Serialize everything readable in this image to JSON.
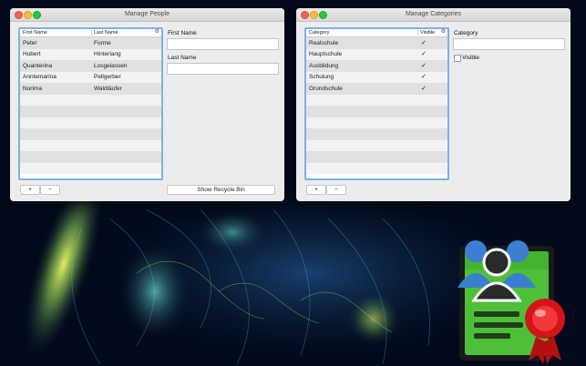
{
  "people_window": {
    "title": "Manage People",
    "columns": [
      "First Name",
      "Last Name"
    ],
    "rows": [
      {
        "first": "Peter",
        "last": "Forme"
      },
      {
        "first": "Hubert",
        "last": "Hinterlang"
      },
      {
        "first": "Quanterina",
        "last": "Losgelassen"
      },
      {
        "first": "Anntemarina",
        "last": "Pellgerber"
      },
      {
        "first": "Nurima",
        "last": "Waldläufer"
      }
    ],
    "add_label": "+",
    "remove_label": "−",
    "first_name_label": "First Name",
    "last_name_label": "Last Name",
    "first_name_value": "",
    "last_name_value": "",
    "recycle_bin_label": "Show Recycle Bin"
  },
  "categories_window": {
    "title": "Manage Categories",
    "columns": [
      "Category",
      "Visible"
    ],
    "rows": [
      {
        "name": "Realschule",
        "visible": "✓"
      },
      {
        "name": "Hauptschule",
        "visible": "✓"
      },
      {
        "name": "Ausbildung",
        "visible": "✓"
      },
      {
        "name": "Schulung",
        "visible": "✓"
      },
      {
        "name": "Grundschule",
        "visible": "✓"
      }
    ],
    "add_label": "+",
    "remove_label": "−",
    "category_label": "Category",
    "category_value": "",
    "visible_label": "Visible"
  },
  "colors": {
    "selection_border": "#7cb1ea",
    "window_bg": "#ececec",
    "close": "#fc5f57",
    "minimize": "#fdbc2e",
    "zoom": "#29c840"
  },
  "icons": [
    "gear-icon",
    "checkmark-icon",
    "app-logo-icon",
    "award-ribbon-icon"
  ]
}
